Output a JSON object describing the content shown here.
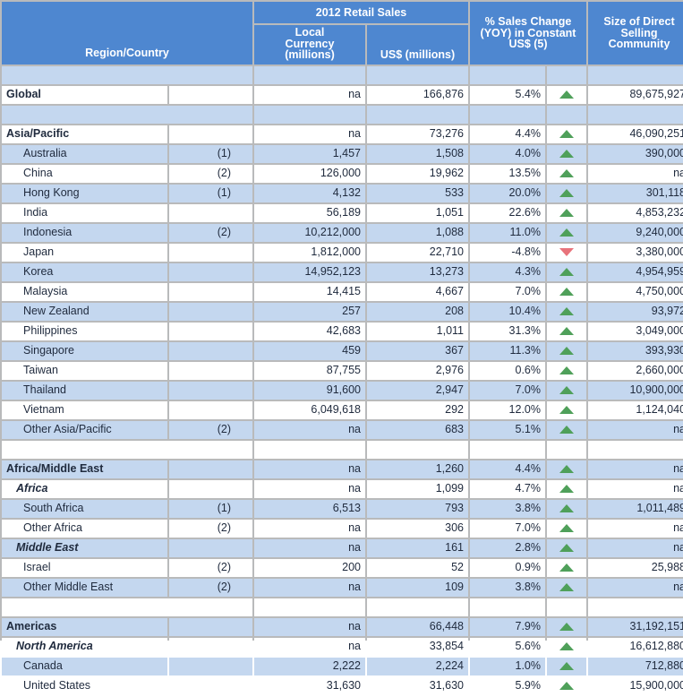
{
  "header": {
    "region_country": "Region/Country",
    "group_retail_sales": "2012 Retail Sales",
    "local_currency": "Local\nCurrency\n(millions)",
    "local_currency_l1": "Local",
    "local_currency_l2": "Currency",
    "local_currency_l3": "(millions)",
    "usd_millions": "US$ (millions)",
    "pct_sales_change_l1": "% Sales Change",
    "pct_sales_change_l2": "(YOY) in Constant",
    "pct_sales_change_l3": "US$ (5)",
    "size_direct_l1": "Size of Direct",
    "size_direct_l2": "Selling",
    "size_direct_l3": "Community"
  },
  "colors": {
    "header_blue": "#4e87d0",
    "stripe_blue": "#c4d7ef",
    "grid_gray": "#b9babb",
    "up_green": "#4fa05a",
    "down_red": "#e8737b"
  },
  "rows": [
    {
      "type": "spacer",
      "stripe": true
    },
    {
      "type": "data",
      "name": "Global",
      "note": "",
      "local": "na",
      "usd": "166,876",
      "pct": "5.4%",
      "dir": "up",
      "size": "89,675,927",
      "style": "bold",
      "indent": 0,
      "stripe": false
    },
    {
      "type": "spacer",
      "stripe": true
    },
    {
      "type": "data",
      "name": "Asia/Pacific",
      "note": "",
      "local": "na",
      "usd": "73,276",
      "pct": "4.4%",
      "dir": "up",
      "size": "46,090,251",
      "style": "bold",
      "indent": 0,
      "stripe": false
    },
    {
      "type": "data",
      "name": "Australia",
      "note": "(1)",
      "local": "1,457",
      "usd": "1,508",
      "pct": "4.0%",
      "dir": "up",
      "size": "390,000",
      "style": "normal",
      "indent": 2,
      "stripe": true
    },
    {
      "type": "data",
      "name": "China",
      "note": "(2)",
      "local": "126,000",
      "usd": "19,962",
      "pct": "13.5%",
      "dir": "up",
      "size": "na",
      "style": "normal",
      "indent": 2,
      "stripe": false
    },
    {
      "type": "data",
      "name": "Hong Kong",
      "note": "(1)",
      "local": "4,132",
      "usd": "533",
      "pct": "20.0%",
      "dir": "up",
      "size": "301,118",
      "style": "normal",
      "indent": 2,
      "stripe": true
    },
    {
      "type": "data",
      "name": "India",
      "note": "",
      "local": "56,189",
      "usd": "1,051",
      "pct": "22.6%",
      "dir": "up",
      "size": "4,853,232",
      "style": "normal",
      "indent": 2,
      "stripe": false
    },
    {
      "type": "data",
      "name": "Indonesia",
      "note": "(2)",
      "local": "10,212,000",
      "usd": "1,088",
      "pct": "11.0%",
      "dir": "up",
      "size": "9,240,000",
      "style": "normal",
      "indent": 2,
      "stripe": true
    },
    {
      "type": "data",
      "name": "Japan",
      "note": "",
      "local": "1,812,000",
      "usd": "22,710",
      "pct": "-4.8%",
      "dir": "down",
      "size": "3,380,000",
      "style": "normal",
      "indent": 2,
      "stripe": false
    },
    {
      "type": "data",
      "name": "Korea",
      "note": "",
      "local": "14,952,123",
      "usd": "13,273",
      "pct": "4.3%",
      "dir": "up",
      "size": "4,954,959",
      "style": "normal",
      "indent": 2,
      "stripe": true
    },
    {
      "type": "data",
      "name": "Malaysia",
      "note": "",
      "local": "14,415",
      "usd": "4,667",
      "pct": "7.0%",
      "dir": "up",
      "size": "4,750,000",
      "style": "normal",
      "indent": 2,
      "stripe": false
    },
    {
      "type": "data",
      "name": "New Zealand",
      "note": "",
      "local": "257",
      "usd": "208",
      "pct": "10.4%",
      "dir": "up",
      "size": "93,972",
      "style": "normal",
      "indent": 2,
      "stripe": true
    },
    {
      "type": "data",
      "name": "Philippines",
      "note": "",
      "local": "42,683",
      "usd": "1,011",
      "pct": "31.3%",
      "dir": "up",
      "size": "3,049,000",
      "style": "normal",
      "indent": 2,
      "stripe": false
    },
    {
      "type": "data",
      "name": "Singapore",
      "note": "",
      "local": "459",
      "usd": "367",
      "pct": "11.3%",
      "dir": "up",
      "size": "393,930",
      "style": "normal",
      "indent": 2,
      "stripe": true
    },
    {
      "type": "data",
      "name": "Taiwan",
      "note": "",
      "local": "87,755",
      "usd": "2,976",
      "pct": "0.6%",
      "dir": "up",
      "size": "2,660,000",
      "style": "normal",
      "indent": 2,
      "stripe": false
    },
    {
      "type": "data",
      "name": "Thailand",
      "note": "",
      "local": "91,600",
      "usd": "2,947",
      "pct": "7.0%",
      "dir": "up",
      "size": "10,900,000",
      "style": "normal",
      "indent": 2,
      "stripe": true
    },
    {
      "type": "data",
      "name": "Vietnam",
      "note": "",
      "local": "6,049,618",
      "usd": "292",
      "pct": "12.0%",
      "dir": "up",
      "size": "1,124,040",
      "style": "normal",
      "indent": 2,
      "stripe": false
    },
    {
      "type": "data",
      "name": "Other Asia/Pacific",
      "note": "(2)",
      "local": "na",
      "usd": "683",
      "pct": "5.1%",
      "dir": "up",
      "size": "na",
      "style": "normal",
      "indent": 2,
      "stripe": true
    },
    {
      "type": "spacer",
      "stripe": false
    },
    {
      "type": "data",
      "name": "Africa/Middle East",
      "note": "",
      "local": "na",
      "usd": "1,260",
      "pct": "4.4%",
      "dir": "up",
      "size": "na",
      "style": "bold",
      "indent": 0,
      "stripe": true
    },
    {
      "type": "data",
      "name": "Africa",
      "note": "",
      "local": "na",
      "usd": "1,099",
      "pct": "4.7%",
      "dir": "up",
      "size": "na",
      "style": "bolditalic",
      "indent": 1,
      "stripe": false
    },
    {
      "type": "data",
      "name": "South Africa",
      "note": "(1)",
      "local": "6,513",
      "usd": "793",
      "pct": "3.8%",
      "dir": "up",
      "size": "1,011,489",
      "style": "normal",
      "indent": 2,
      "stripe": true
    },
    {
      "type": "data",
      "name": "Other Africa",
      "note": "(2)",
      "local": "na",
      "usd": "306",
      "pct": "7.0%",
      "dir": "up",
      "size": "na",
      "style": "normal",
      "indent": 2,
      "stripe": false
    },
    {
      "type": "data",
      "name": "Middle East",
      "note": "",
      "local": "na",
      "usd": "161",
      "pct": "2.8%",
      "dir": "up",
      "size": "na",
      "style": "bolditalic",
      "indent": 1,
      "stripe": true
    },
    {
      "type": "data",
      "name": "Israel",
      "note": "(2)",
      "local": "200",
      "usd": "52",
      "pct": "0.9%",
      "dir": "up",
      "size": "25,988",
      "style": "normal",
      "indent": 2,
      "stripe": false
    },
    {
      "type": "data",
      "name": "Other Middle East",
      "note": "(2)",
      "local": "na",
      "usd": "109",
      "pct": "3.8%",
      "dir": "up",
      "size": "na",
      "style": "normal",
      "indent": 2,
      "stripe": true
    },
    {
      "type": "spacer",
      "stripe": false
    },
    {
      "type": "data",
      "name": "Americas",
      "note": "",
      "local": "na",
      "usd": "66,448",
      "pct": "7.9%",
      "dir": "up",
      "size": "31,192,151",
      "style": "bold",
      "indent": 0,
      "stripe": true
    },
    {
      "type": "data",
      "name": "North America",
      "note": "",
      "local": "na",
      "usd": "33,854",
      "pct": "5.6%",
      "dir": "up",
      "size": "16,612,880",
      "style": "bolditalic",
      "indent": 1,
      "stripe": false
    },
    {
      "type": "data",
      "name": "Canada",
      "note": "",
      "local": "2,222",
      "usd": "2,224",
      "pct": "1.0%",
      "dir": "up",
      "size": "712,880",
      "style": "normal",
      "indent": 2,
      "stripe": true
    },
    {
      "type": "data",
      "name": "United States",
      "note": "",
      "local": "31,630",
      "usd": "31,630",
      "pct": "5.9%",
      "dir": "up",
      "size": "15,900,000",
      "style": "normal",
      "indent": 2,
      "stripe": false
    }
  ]
}
